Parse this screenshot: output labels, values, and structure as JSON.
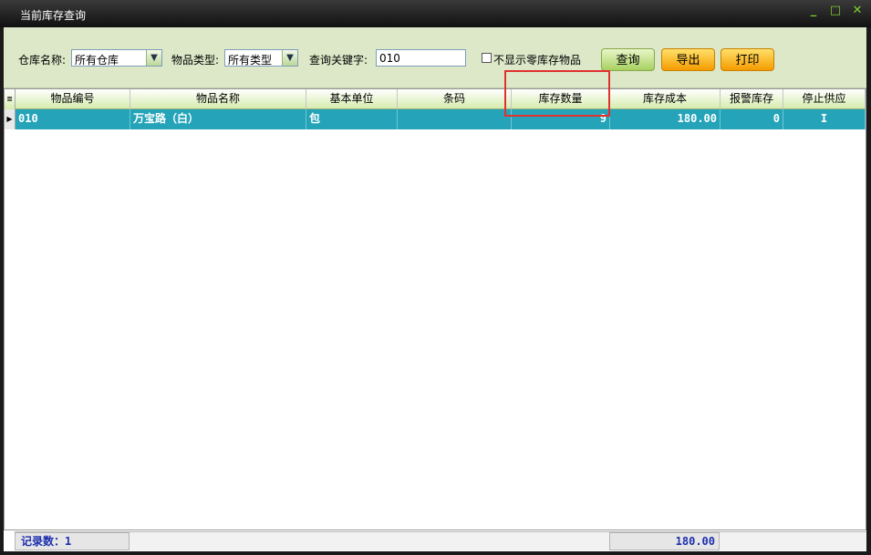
{
  "window": {
    "title": "当前库存查询",
    "controls": [
      "_",
      "□",
      "✕"
    ]
  },
  "filters": {
    "warehouse_label": "仓库名称:",
    "warehouse_value": "所有仓库",
    "category_label": "物品类型:",
    "category_value": "所有类型",
    "keyword_label": "查询关键字:",
    "keyword_value": "010",
    "hide_zero_label": "不显示零库存物品",
    "hide_zero_checked": false
  },
  "buttons": {
    "query": "查询",
    "export": "导出",
    "print": "打印"
  },
  "table": {
    "columns": [
      "物品编号",
      "物品名称",
      "基本单位",
      "条码",
      "库存数量",
      "库存成本",
      "报警库存",
      "停止供应"
    ],
    "rows": [
      {
        "code": "010",
        "name": "万宝路（白）",
        "unit": "包",
        "barcode": "",
        "qty": "9",
        "cost": "180.00",
        "alarm": "0",
        "stop": "I"
      }
    ]
  },
  "footer": {
    "record_count": "记录数：1",
    "total_cost": "180.00"
  },
  "colors": {
    "selected_row": "#25a4b9",
    "highlight_box": "#e03030",
    "toolbar_bg": "#dce8c8",
    "accent_green": "#7fd12a"
  }
}
